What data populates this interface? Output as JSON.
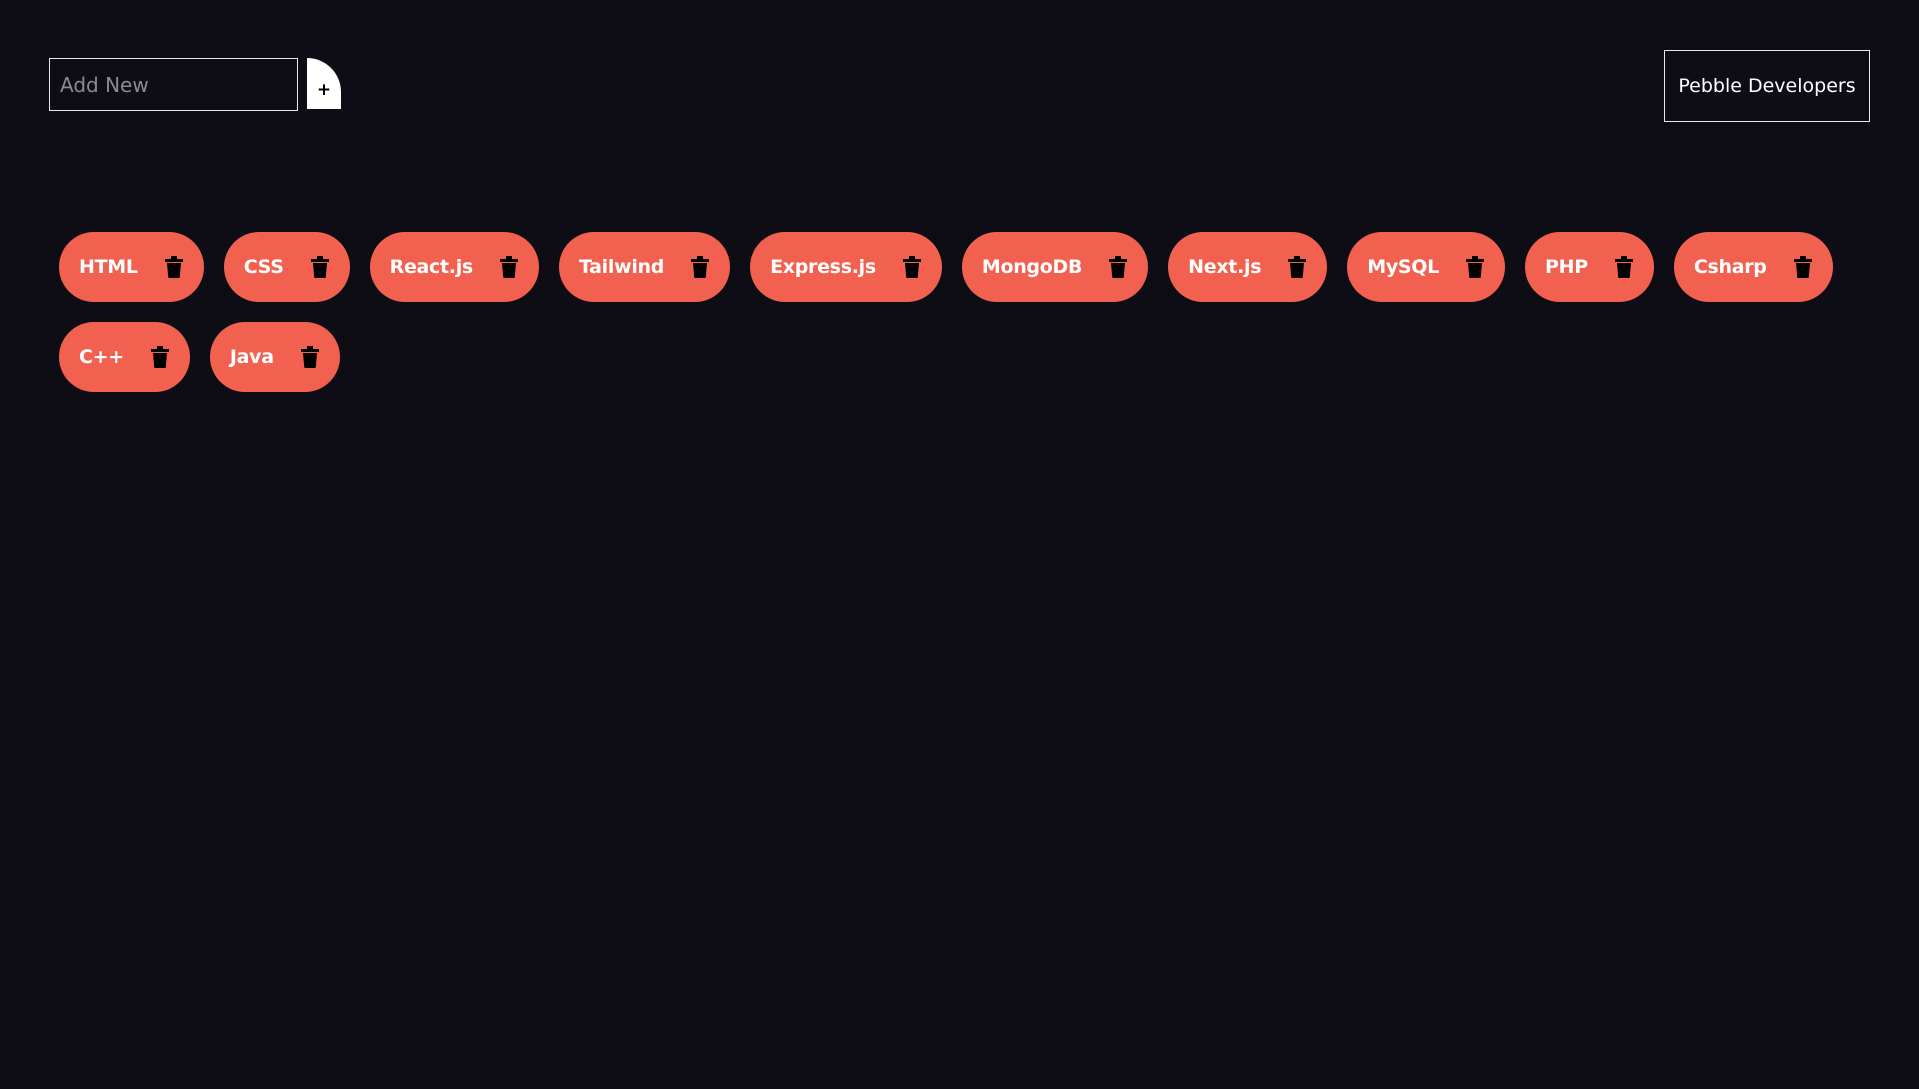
{
  "form": {
    "input_placeholder": "Add New",
    "add_label": "+"
  },
  "header": {
    "brand_label": "Pebble Developers"
  },
  "tags": [
    {
      "label": "HTML"
    },
    {
      "label": "CSS"
    },
    {
      "label": "React.js"
    },
    {
      "label": "Tailwind"
    },
    {
      "label": "Express.js"
    },
    {
      "label": "MongoDB"
    },
    {
      "label": "Next.js"
    },
    {
      "label": "MySQL"
    },
    {
      "label": "PHP"
    },
    {
      "label": "Csharp"
    },
    {
      "label": "C++"
    },
    {
      "label": "Java"
    }
  ],
  "icons": {
    "delete": "trash-icon"
  },
  "colors": {
    "background": "#0e0d16",
    "tag": "#f26150",
    "tag_text": "#ffffff",
    "icon": "#000000"
  }
}
